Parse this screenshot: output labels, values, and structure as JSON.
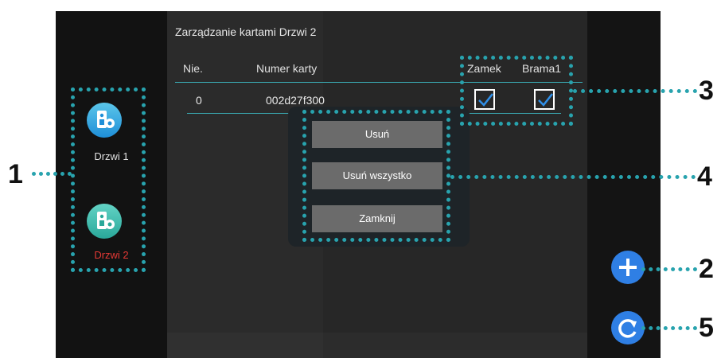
{
  "title": "Zarządzanie kartami Drzwi 2",
  "table": {
    "headers": [
      "Nie.",
      "Numer karty",
      "Zamek",
      "Brama1"
    ],
    "rows": [
      {
        "no": "0",
        "card": "002d27f300",
        "zamek": true,
        "brama1": true
      }
    ]
  },
  "devices": [
    {
      "label": "Drzwi 1",
      "color": "#e0e0e0",
      "icon": "door-station-icon"
    },
    {
      "label": "Drzwi 2",
      "color": "#e53935",
      "icon": "door-station-icon"
    }
  ],
  "modal": {
    "buttons": [
      "Usuń",
      "Usuń wszystko",
      "Zamknij"
    ]
  },
  "fabs": {
    "add_icon": "plus-icon",
    "refresh_icon": "refresh-icon",
    "color": "#2f7fe4"
  },
  "callouts": [
    "1",
    "2",
    "3",
    "4",
    "5"
  ],
  "colors": {
    "accent": "#28a3ae",
    "device_gradient_top": "#4fc3e8",
    "device_gradient_bottom": "#1e88e5"
  }
}
